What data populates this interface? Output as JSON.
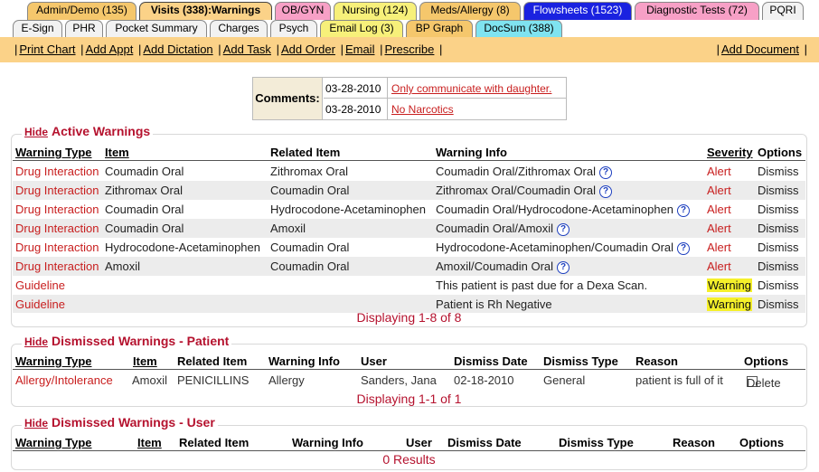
{
  "tabs_row1": [
    {
      "label": "Admin/Demo (135)",
      "color": "#f5c76c"
    },
    {
      "label": "Visits (338):Warnings",
      "color": "#fbd288",
      "active": true
    },
    {
      "label": "OB/GYN",
      "color": "#f7a0c6"
    },
    {
      "label": "Nursing (124)",
      "color": "#f7f07a"
    },
    {
      "label": "Meds/Allergy (8)",
      "color": "#f5c76c"
    },
    {
      "label": "Flowsheets (1523)",
      "color": "#1a22e0"
    },
    {
      "label": "Diagnostic Tests (72)",
      "color": "#f7a0c6"
    },
    {
      "label": "PQRI",
      "color": "#f2f2f2"
    }
  ],
  "tabs_row2": [
    {
      "label": "E-Sign",
      "color": "#f2f2f2"
    },
    {
      "label": "PHR",
      "color": "#f2f2f2"
    },
    {
      "label": "Pocket Summary",
      "color": "#f2f2f2"
    },
    {
      "label": "Charges",
      "color": "#f2f2f2"
    },
    {
      "label": "Psych",
      "color": "#f2f2f2"
    },
    {
      "label": "Email Log (3)",
      "color": "#f7f07a"
    },
    {
      "label": "BP Graph",
      "color": "#f5c76c"
    },
    {
      "label": "DocSum (388)",
      "color": "#7fe3f0"
    }
  ],
  "menu": {
    "print_chart": "Print Chart",
    "add_appt": "Add Appt",
    "add_dictation": "Add Dictation",
    "add_task": "Add Task",
    "add_order": "Add Order",
    "email": "Email",
    "prescribe": "Prescribe",
    "add_document": "Add Document"
  },
  "comments": {
    "label": "Comments:",
    "items": [
      {
        "date": "03-28-2010",
        "text": "Only communicate with daughter."
      },
      {
        "date": "03-28-2010",
        "text": "No Narcotics"
      }
    ]
  },
  "active": {
    "hide": "Hide",
    "title": "Active Warnings",
    "headers": {
      "type": "Warning Type",
      "item": "Item",
      "related": "Related Item",
      "info": "Warning Info",
      "severity": "Severity",
      "options": "Options"
    },
    "rows": [
      {
        "type": "Drug Interaction",
        "item": "Coumadin Oral",
        "related": "Zithromax Oral",
        "info": "Coumadin Oral/Zithromax Oral",
        "help": true,
        "severity": "Alert",
        "option": "Dismiss"
      },
      {
        "type": "Drug Interaction",
        "item": "Zithromax Oral",
        "related": "Coumadin Oral",
        "info": "Zithromax Oral/Coumadin Oral",
        "help": true,
        "severity": "Alert",
        "option": "Dismiss"
      },
      {
        "type": "Drug Interaction",
        "item": "Coumadin Oral",
        "related": "Hydrocodone-Acetaminophen",
        "info": "Coumadin Oral/Hydrocodone-Acetaminophen",
        "help": true,
        "severity": "Alert",
        "option": "Dismiss"
      },
      {
        "type": "Drug Interaction",
        "item": "Coumadin Oral",
        "related": "Amoxil",
        "info": "Coumadin Oral/Amoxil",
        "help": true,
        "severity": "Alert",
        "option": "Dismiss"
      },
      {
        "type": "Drug Interaction",
        "item": "Hydrocodone-Acetaminophen",
        "related": "Coumadin Oral",
        "info": "Hydrocodone-Acetaminophen/Coumadin Oral",
        "help": true,
        "severity": "Alert",
        "option": "Dismiss"
      },
      {
        "type": "Drug Interaction",
        "item": "Amoxil",
        "related": "Coumadin Oral",
        "info": "Amoxil/Coumadin Oral",
        "help": true,
        "severity": "Alert",
        "option": "Dismiss"
      },
      {
        "type": "Guideline",
        "item": "",
        "related": "",
        "info": "This patient is past due for a Dexa Scan.",
        "help": false,
        "severity": "Warning",
        "option": "Dismiss"
      },
      {
        "type": "Guideline",
        "item": "",
        "related": "",
        "info": "Patient is Rh Negative",
        "help": false,
        "severity": "Warning",
        "option": "Dismiss"
      }
    ],
    "footer": "Displaying 1-8 of 8"
  },
  "dismissed_patient": {
    "hide": "Hide",
    "title": "Dismissed Warnings - Patient",
    "headers": {
      "type": "Warning Type",
      "item": "Item",
      "related": "Related Item",
      "info": "Warning Info",
      "user": "User",
      "date": "Dismiss Date",
      "dtype": "Dismiss Type",
      "reason": "Reason",
      "options": "Options"
    },
    "rows": [
      {
        "type": "Allergy/Intolerance",
        "item": "Amoxil",
        "related": "PENICILLINS",
        "info": "Allergy",
        "user": "Sanders, Jana",
        "date": "02-18-2010",
        "dtype": "General",
        "reason": "patient is full of it",
        "option": "Delete"
      }
    ],
    "footer": "Displaying 1-1 of 1"
  },
  "dismissed_user": {
    "hide": "Hide",
    "title": "Dismissed Warnings - User",
    "headers": {
      "type": "Warning Type",
      "item": "Item",
      "related": "Related Item",
      "info": "Warning Info",
      "user": "User",
      "date": "Dismiss Date",
      "dtype": "Dismiss Type",
      "reason": "Reason",
      "options": "Options"
    },
    "footer": "0 Results"
  }
}
